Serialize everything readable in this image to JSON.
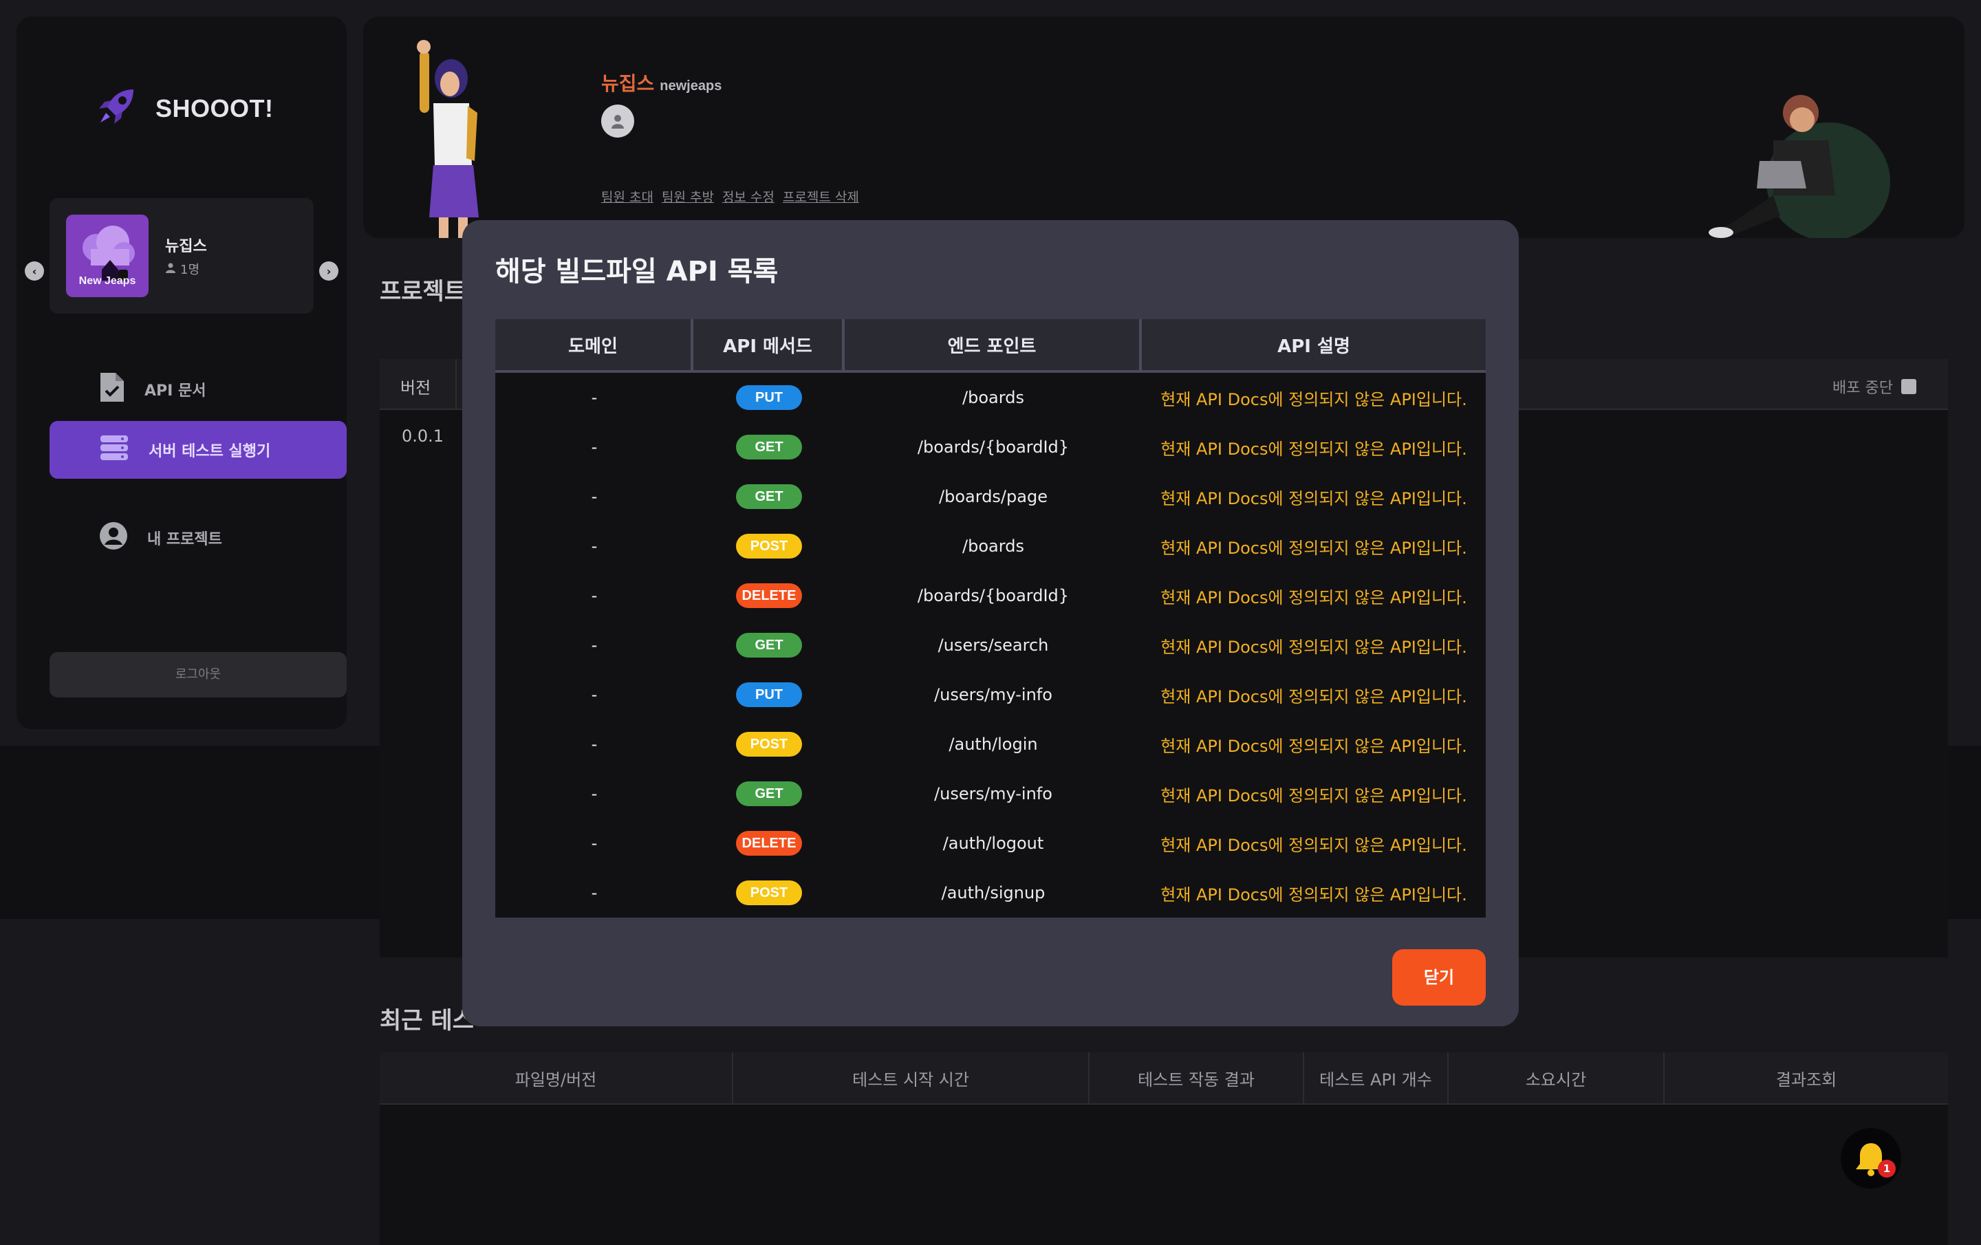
{
  "brand": {
    "name": "SHOOOT!"
  },
  "project_card": {
    "thumb_label": "New Jeaps",
    "name": "뉴집스",
    "members": "1명"
  },
  "nav": [
    {
      "label": "API 문서",
      "icon": "document-check-icon",
      "active": false
    },
    {
      "label": "서버 테스트 실행기",
      "icon": "server-icon",
      "active": true
    },
    {
      "label": "내 프로젝트",
      "icon": "user-circle-icon",
      "active": false
    }
  ],
  "logout_label": "로그아웃",
  "header": {
    "project_kr": "뉴집스",
    "project_en": "newjeaps",
    "links": [
      "팀원 초대",
      "팀원 추방",
      "정보 수정",
      "프로젝트 삭제"
    ]
  },
  "page": {
    "section_project": "프로젝트",
    "version_header": "버전",
    "version_value": "0.0.1",
    "deploy_stop": "배포 중단",
    "section_recent": "최근 테스",
    "recent_headers": [
      "파일명/버전",
      "테스트 시작 시간",
      "테스트 작동 결과",
      "테스트 API 개수",
      "소요시간",
      "결과조회"
    ],
    "notification_count": "1"
  },
  "modal": {
    "title": "해당 빌드파일 API 목록",
    "headers": [
      "도메인",
      "API 메서드",
      "엔드 포인트",
      "API 설명"
    ],
    "rows": [
      {
        "domain": "-",
        "method": "PUT",
        "endpoint": "/boards",
        "desc": "현재 API Docs에 정의되지 않은 API입니다."
      },
      {
        "domain": "-",
        "method": "GET",
        "endpoint": "/boards/{boardId}",
        "desc": "현재 API Docs에 정의되지 않은 API입니다."
      },
      {
        "domain": "-",
        "method": "GET",
        "endpoint": "/boards/page",
        "desc": "현재 API Docs에 정의되지 않은 API입니다."
      },
      {
        "domain": "-",
        "method": "POST",
        "endpoint": "/boards",
        "desc": "현재 API Docs에 정의되지 않은 API입니다."
      },
      {
        "domain": "-",
        "method": "DELETE",
        "endpoint": "/boards/{boardId}",
        "desc": "현재 API Docs에 정의되지 않은 API입니다."
      },
      {
        "domain": "-",
        "method": "GET",
        "endpoint": "/users/search",
        "desc": "현재 API Docs에 정의되지 않은 API입니다."
      },
      {
        "domain": "-",
        "method": "PUT",
        "endpoint": "/users/my-info",
        "desc": "현재 API Docs에 정의되지 않은 API입니다."
      },
      {
        "domain": "-",
        "method": "POST",
        "endpoint": "/auth/login",
        "desc": "현재 API Docs에 정의되지 않은 API입니다."
      },
      {
        "domain": "-",
        "method": "GET",
        "endpoint": "/users/my-info",
        "desc": "현재 API Docs에 정의되지 않은 API입니다."
      },
      {
        "domain": "-",
        "method": "DELETE",
        "endpoint": "/auth/logout",
        "desc": "현재 API Docs에 정의되지 않은 API입니다."
      },
      {
        "domain": "-",
        "method": "POST",
        "endpoint": "/auth/signup",
        "desc": "현재 API Docs에 정의되지 않은 API입니다."
      }
    ],
    "close_label": "닫기"
  },
  "colors": {
    "accent_purple": "#6a3fc4",
    "accent_orange": "#f4531d",
    "method_put": "#1e88e5",
    "method_get": "#43a047",
    "method_post": "#f9c513",
    "method_delete": "#f4511e",
    "desc_warning": "#f2b01e"
  }
}
